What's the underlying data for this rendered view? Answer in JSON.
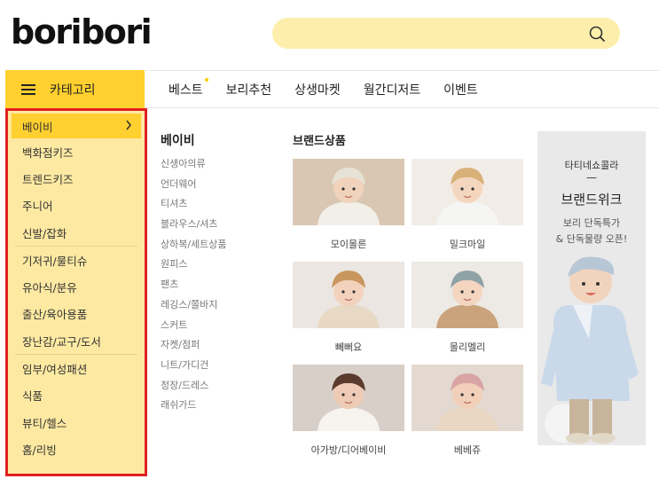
{
  "header": {
    "logo": "boribori",
    "search": {
      "placeholder": ""
    }
  },
  "category_button": {
    "label": "카테고리"
  },
  "topnav": [
    {
      "label": "베스트",
      "new": true
    },
    {
      "label": "보리추천"
    },
    {
      "label": "상생마켓"
    },
    {
      "label": "월간디저트"
    },
    {
      "label": "이벤트"
    }
  ],
  "sidebar": {
    "items": [
      "베이비",
      "백화점키즈",
      "트렌드키즈",
      "주니어",
      "신발/잡화",
      "기저귀/물티슈",
      "유아식/분유",
      "출산/육아용품",
      "장난감/교구/도서",
      "임부/여성패션",
      "식품",
      "뷰티/헬스",
      "홈/리빙"
    ]
  },
  "submenu": {
    "title": "베이비",
    "items": [
      "신생아의류",
      "언더웨어",
      "티셔츠",
      "블라우스/셔츠",
      "상하복/세트상품",
      "원피스",
      "팬츠",
      "레깅스/쫄바지",
      "스커트",
      "자켓/점퍼",
      "니트/가디건",
      "정장/드레스",
      "래쉬가드"
    ]
  },
  "brands": {
    "title": "브랜드상품",
    "items": [
      {
        "name": "모이몰른",
        "bg": "#d9c7b3",
        "skin": "#f1d3bb",
        "cloth": "#f2efe8",
        "hair": "#e8e2d6"
      },
      {
        "name": "밀크마일",
        "bg": "#f2ece6",
        "skin": "#f4d6bf",
        "cloth": "#f5f5f3",
        "hair": "#d8b178"
      },
      {
        "name": "뻬뻐요",
        "bg": "#ebe6e1",
        "skin": "#f2d2bc",
        "cloth": "#e8d9c4",
        "hair": "#c8965e"
      },
      {
        "name": "몰리멜리",
        "bg": "#ede9e4",
        "skin": "#f3d5c0",
        "cloth": "#caa37d",
        "hair": "#8fa2a6"
      },
      {
        "name": "아가방/디어베이비",
        "bg": "#d8cfc8",
        "skin": "#eecbb5",
        "cloth": "#f7f3ee",
        "hair": "#5a3b2d"
      },
      {
        "name": "베베쥬",
        "bg": "#e3d9d0",
        "skin": "#f1cfb9",
        "cloth": "#e9d7c3",
        "hair": "#d9a4a4"
      }
    ]
  },
  "banner": {
    "line1": "타티네쇼콜라",
    "dash": "—",
    "title": "브랜드위크",
    "desc1": "보리 단독특가",
    "desc2": "& 단독물량 오픈!"
  }
}
